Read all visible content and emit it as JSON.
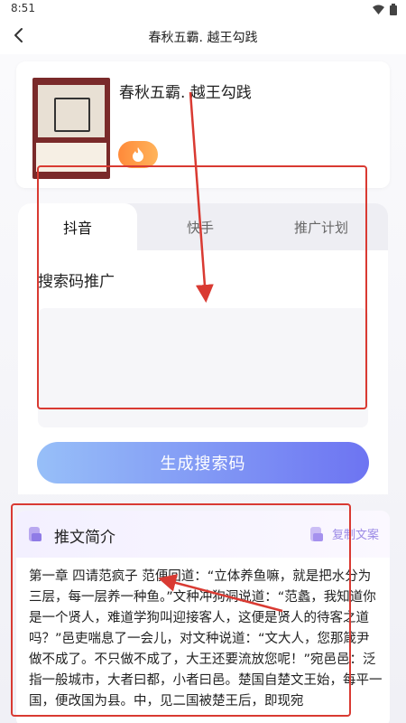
{
  "status": {
    "time": "8:51"
  },
  "appbar": {
    "title": "春秋五霸. 越王勾践"
  },
  "book": {
    "title": "春秋五霸. 越王勾践"
  },
  "tabs": [
    {
      "label": "抖音",
      "active": true
    },
    {
      "label": "快手",
      "active": false
    },
    {
      "label": "推广计划",
      "active": false
    }
  ],
  "search_code": {
    "label": "搜索码推广",
    "value": ""
  },
  "generate_button": {
    "label": "生成搜索码"
  },
  "intro": {
    "title": "推文简介",
    "copy_label": "复制文案",
    "text": "第一章 四请范疯子 范便回道：“立体养鱼嘛，就是把水分为三层，每一层养一种鱼。”文种冲狗洞说道：“范蠡，我知道你是一个贤人，难道学狗叫迎接客人，这便是贤人的待客之道吗？”邑吏喘息了一会儿，对文种说道：“文大人，您那箴尹做不成了。不只做不成了，大王还要流放您呢！”宛邑邑：泛指一般城市，大者曰都，小者曰邑。楚国自楚文王始，每平一国，便改国为县。中，见二国被楚王后，即现宛"
  },
  "colors": {
    "accent": "#6d74f2",
    "annotation": "#d93a32",
    "copy": "#9b8ae6"
  }
}
